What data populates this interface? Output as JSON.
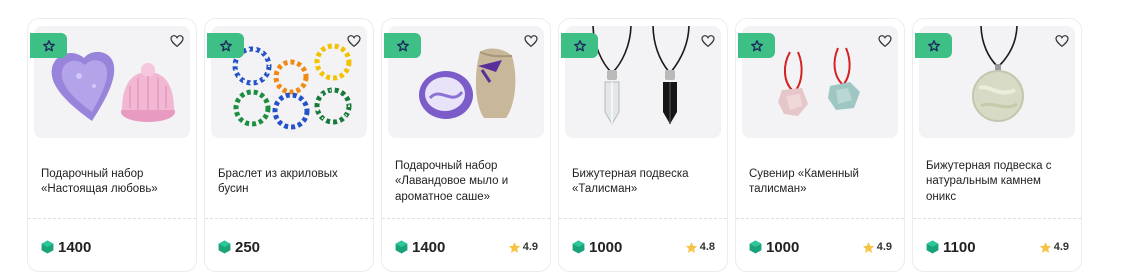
{
  "colors": {
    "badge": "#3dbf86",
    "currency_gem": "#1aa37a",
    "star": "#f6c343"
  },
  "icons": {
    "badge": "star-outline-icon",
    "favorite": "heart-outline-icon",
    "currency": "gem-icon",
    "rating": "star-filled-icon"
  },
  "products": [
    {
      "title": "Подарочный набор «Настоящая любовь»",
      "price": "1400",
      "rating": ""
    },
    {
      "title": "Браслет из акриловых бусин",
      "price": "250",
      "rating": ""
    },
    {
      "title": "Подарочный набор «Лавандовое мыло и ароматное саше»",
      "price": "1400",
      "rating": "4.9"
    },
    {
      "title": "Бижутерная подвеска «Талисман»",
      "price": "1000",
      "rating": "4.8"
    },
    {
      "title": "Сувенир «Каменный талисман»",
      "price": "1000",
      "rating": "4.9"
    },
    {
      "title": "Бижутерная подвеска с натуральным камнем оникс",
      "price": "1100",
      "rating": "4.9"
    }
  ]
}
